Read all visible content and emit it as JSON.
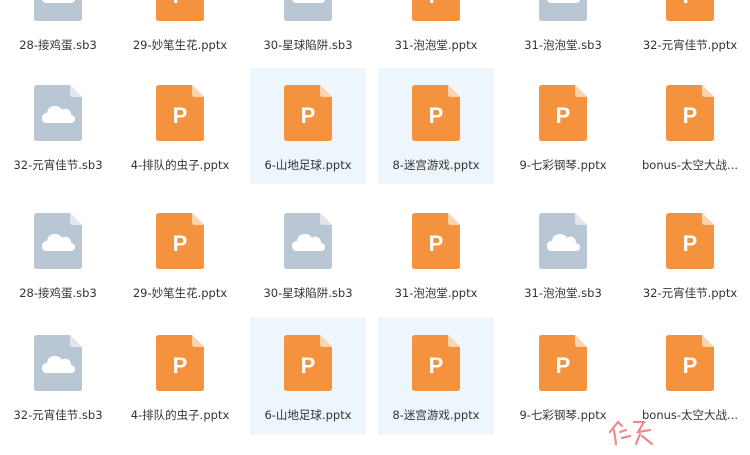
{
  "colors": {
    "pptx": "#f5923e",
    "pptx_fold": "#fbd3ad",
    "sb3": "#b9c6d3",
    "sb3_fold": "#e0e6ed",
    "selected_bg": "#eef6fd",
    "watermark": "#e8626a"
  },
  "icons": {
    "pptx": "ppt-file-icon",
    "sb3": "cloud-file-icon",
    "pptx_letter": "P"
  },
  "rows": [
    {
      "files": [
        {
          "name": "28-接鸡蛋.sb3",
          "type": "sb3"
        },
        {
          "name": "29-妙笔生花.pptx",
          "type": "pptx"
        },
        {
          "name": "30-星球陷阱.sb3",
          "type": "sb3"
        },
        {
          "name": "31-泡泡堂.pptx",
          "type": "pptx"
        },
        {
          "name": "31-泡泡堂.sb3",
          "type": "sb3"
        },
        {
          "name": "32-元宵佳节.pptx",
          "type": "pptx"
        }
      ]
    },
    {
      "files": [
        {
          "name": "32-元宵佳节.sb3",
          "type": "sb3"
        },
        {
          "name": "4-排队的虫子.pptx",
          "type": "pptx"
        },
        {
          "name": "6-山地足球.pptx",
          "type": "pptx",
          "selected": true
        },
        {
          "name": "8-迷宫游戏.pptx",
          "type": "pptx",
          "selected": true
        },
        {
          "name": "9-七彩钢琴.pptx",
          "type": "pptx"
        },
        {
          "name": "bonus-太空大战...",
          "type": "pptx"
        }
      ]
    },
    {
      "files": [
        {
          "name": "28-接鸡蛋.sb3",
          "type": "sb3"
        },
        {
          "name": "29-妙笔生花.pptx",
          "type": "pptx"
        },
        {
          "name": "30-星球陷阱.sb3",
          "type": "sb3"
        },
        {
          "name": "31-泡泡堂.pptx",
          "type": "pptx"
        },
        {
          "name": "31-泡泡堂.sb3",
          "type": "sb3"
        },
        {
          "name": "32-元宵佳节.pptx",
          "type": "pptx"
        }
      ]
    },
    {
      "files": [
        {
          "name": "32-元宵佳节.sb3",
          "type": "sb3"
        },
        {
          "name": "4-排队的虫子.pptx",
          "type": "pptx"
        },
        {
          "name": "6-山地足球.pptx",
          "type": "pptx",
          "selected": true
        },
        {
          "name": "8-迷宫游戏.pptx",
          "type": "pptx",
          "selected": true
        },
        {
          "name": "9-七彩钢琴.pptx",
          "type": "pptx"
        },
        {
          "name": "bonus-太空大战...",
          "type": "pptx"
        }
      ]
    }
  ]
}
